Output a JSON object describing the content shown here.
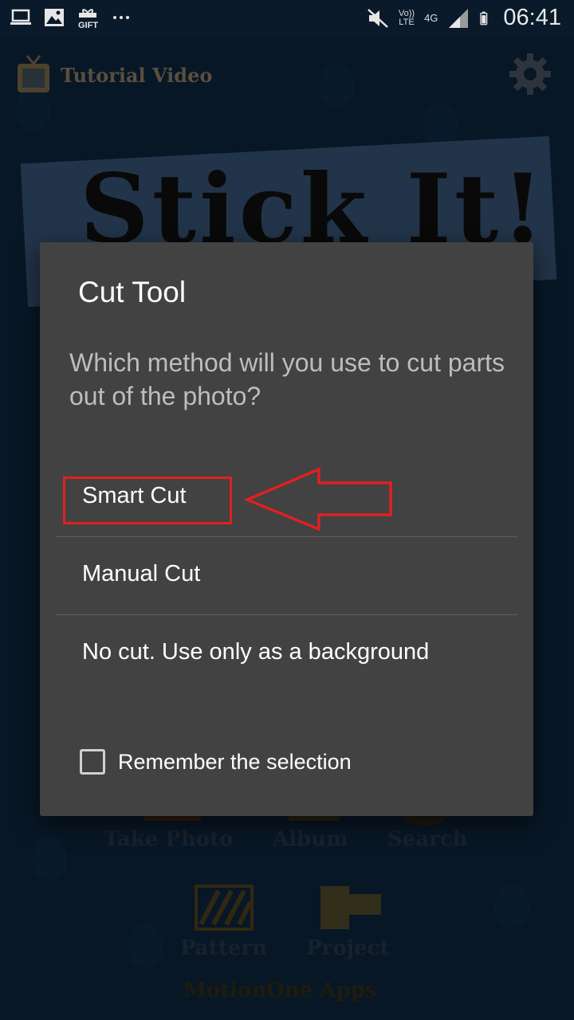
{
  "status_bar": {
    "time": "06:41",
    "volte": "Vo))",
    "lte": "LTE",
    "network": "4G",
    "icons": [
      "laptop-icon",
      "image-icon",
      "gift-icon",
      "more-icon",
      "mute-icon",
      "signal-icon",
      "battery-icon"
    ]
  },
  "app": {
    "tutorial_label": "Tutorial Video",
    "banner_text": "Stick It!",
    "home_items": [
      {
        "label": "Take Photo"
      },
      {
        "label": "Album"
      },
      {
        "label": "Search"
      },
      {
        "label": "Pattern"
      },
      {
        "label": "Project"
      }
    ],
    "footer_brand": "MotionOne Apps"
  },
  "dialog": {
    "title": "Cut Tool",
    "message": "Which method will you use to cut parts out of the photo?",
    "options": [
      {
        "label": "Smart Cut"
      },
      {
        "label": "Manual Cut"
      },
      {
        "label": "No cut. Use only as a background"
      }
    ],
    "remember_label": "Remember the selection",
    "remember_checked": false
  },
  "colors": {
    "dialog_bg": "#424242",
    "annotation_red": "#e02020",
    "app_bg": "#0f2a46"
  }
}
